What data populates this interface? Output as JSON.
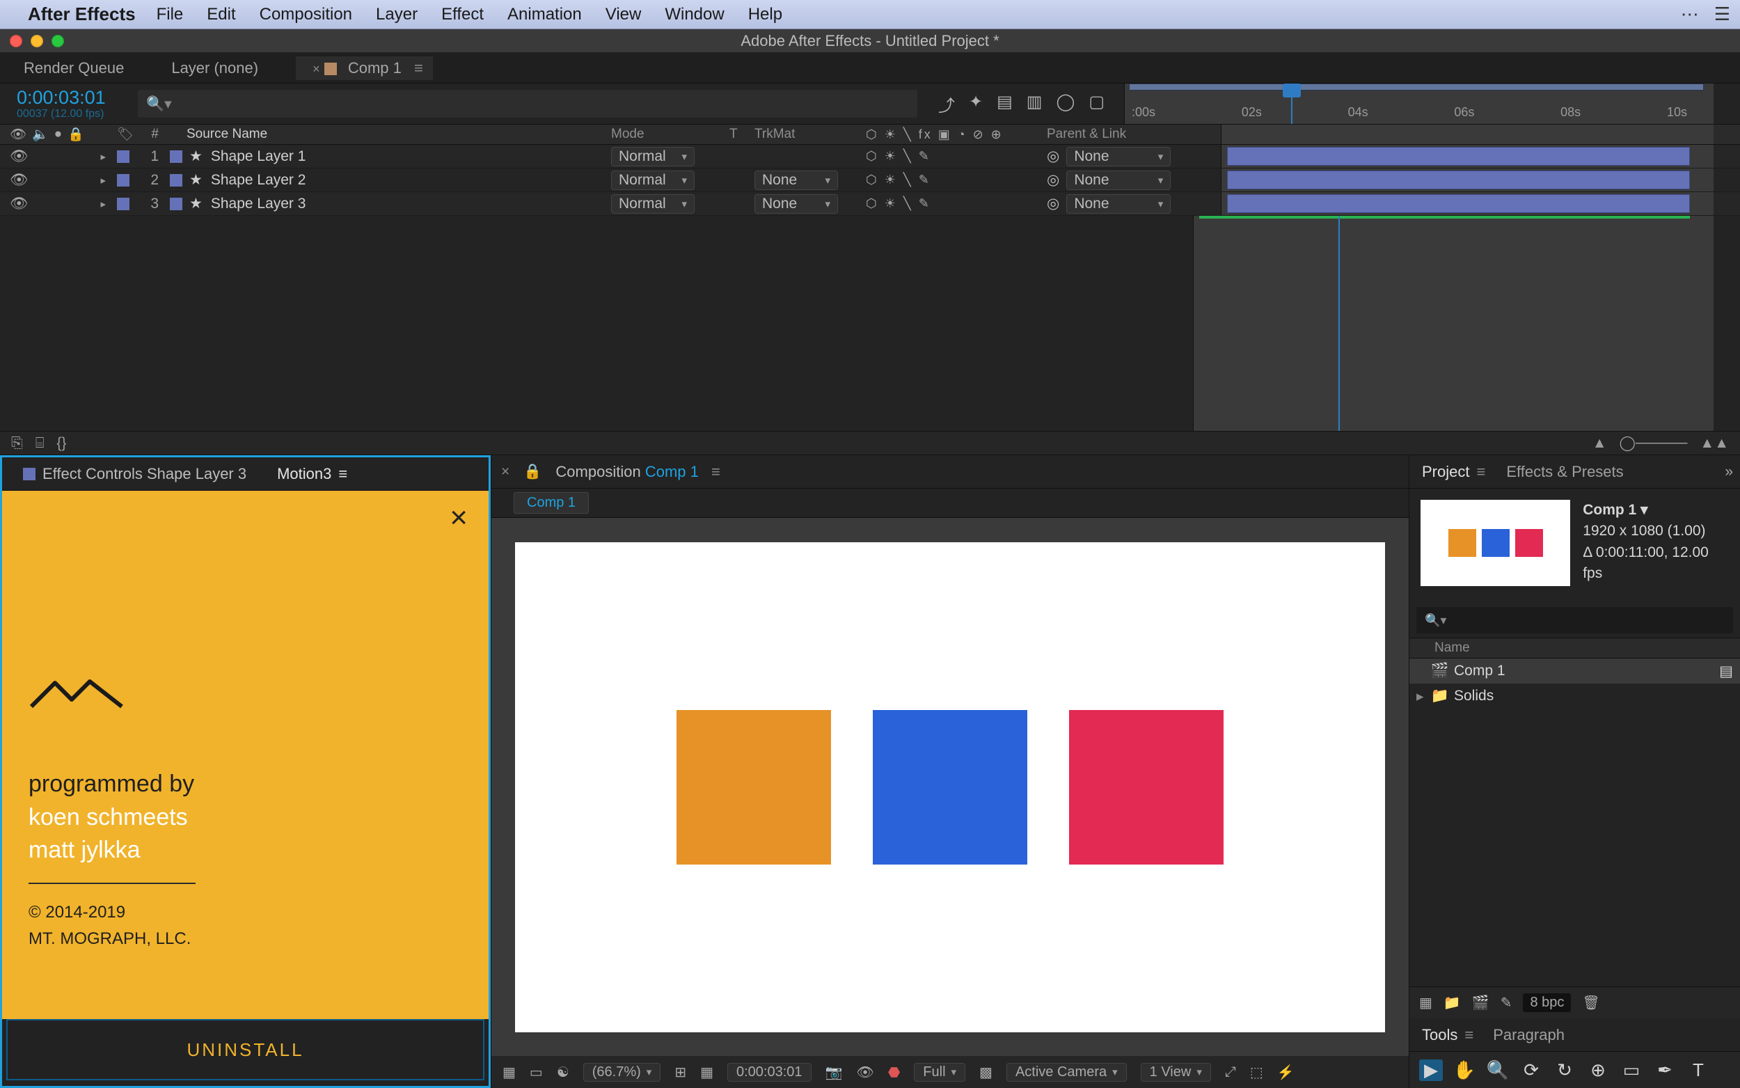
{
  "mac_menu": {
    "app": "After Effects",
    "items": [
      "File",
      "Edit",
      "Composition",
      "Layer",
      "Effect",
      "Animation",
      "View",
      "Window",
      "Help"
    ]
  },
  "app_title": "Adobe After Effects - Untitled Project *",
  "timeline": {
    "tabs": {
      "render": "Render Queue",
      "layer": "Layer (none)",
      "comp": "Comp 1"
    },
    "timecode": "0:00:03:01",
    "frameinfo": "00037 (12.00 fps)",
    "ruler_labels": [
      ":00s",
      "02s",
      "04s",
      "06s",
      "08s",
      "10s"
    ],
    "columns": {
      "num": "#",
      "source": "Source Name",
      "mode": "Mode",
      "t": "T",
      "trk": "TrkMat",
      "parent": "Parent & Link"
    },
    "layers": [
      {
        "n": "1",
        "name": "Shape Layer 1",
        "mode": "Normal",
        "trk": "",
        "parent": "None"
      },
      {
        "n": "2",
        "name": "Shape Layer 2",
        "mode": "Normal",
        "trk": "None",
        "parent": "None"
      },
      {
        "n": "3",
        "name": "Shape Layer 3",
        "mode": "Normal",
        "trk": "None",
        "parent": "None"
      }
    ],
    "switches": "⬡ ☀ ╲  fx  ▣ ◔ ⊘ ⊕"
  },
  "left_panel": {
    "tab1": "Effect Controls Shape Layer 3",
    "tab2": "Motion3",
    "heading": "programmed by",
    "line1": "koen schmeets",
    "line2": "matt jylkka",
    "copyright": "© 2014-2019",
    "company": "MT. MOGRAPH, LLC.",
    "btn": "UNINSTALL"
  },
  "viewer": {
    "tab_prefix": "Composition",
    "tab_name": "Comp 1",
    "breadcrumb": "Comp 1",
    "colors": {
      "orange": "#e79227",
      "blue": "#2a62d9",
      "red": "#e22a53"
    },
    "footer": {
      "zoom": "(66.7%)",
      "time": "0:00:03:01",
      "res": "Full",
      "cam": "Active Camera",
      "view": "1 View"
    }
  },
  "project": {
    "tab1": "Project",
    "tab2": "Effects & Presets",
    "name": "Comp 1",
    "dims": "1920 x 1080 (1.00)",
    "dur": "Δ 0:00:11:00, 12.00 fps",
    "col": "Name",
    "items": [
      {
        "name": "Comp 1",
        "type": "comp"
      },
      {
        "name": "Solids",
        "type": "folder"
      }
    ],
    "bpc": "8 bpc",
    "tools_tab": "Tools",
    "para_tab": "Paragraph"
  }
}
